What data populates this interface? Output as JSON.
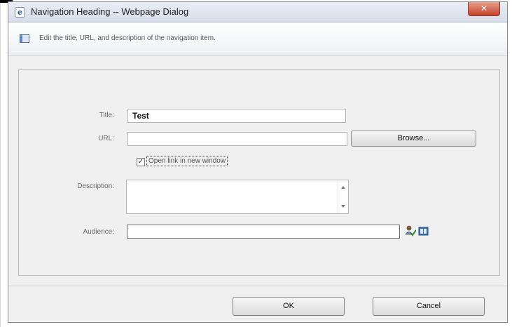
{
  "window": {
    "title": "Navigation Heading -- Webpage Dialog",
    "close_label": "✕",
    "app_icon_glyph": "e"
  },
  "header": {
    "text": "Edit the title, URL, and description of the navigation item."
  },
  "form": {
    "title_label": "Title:",
    "title_value": "Test",
    "url_label": "URL:",
    "url_value": "",
    "browse_label": "Browse...",
    "new_window_checked": true,
    "new_window_check_glyph": "✓",
    "new_window_label": "Open link in new window",
    "description_label": "Description:",
    "description_value": "",
    "audience_label": "Audience:",
    "audience_value": ""
  },
  "buttons": {
    "ok": "OK",
    "cancel": "Cancel"
  },
  "icons": {
    "app": "ie-document-icon",
    "header": "navigation-list-icon",
    "check_names": "check-names-icon",
    "browse_audience": "address-book-icon"
  },
  "colors": {
    "close_button": "#c6402a",
    "dialog_background": "#f0f0f0",
    "titlebar": "#d6deea"
  }
}
